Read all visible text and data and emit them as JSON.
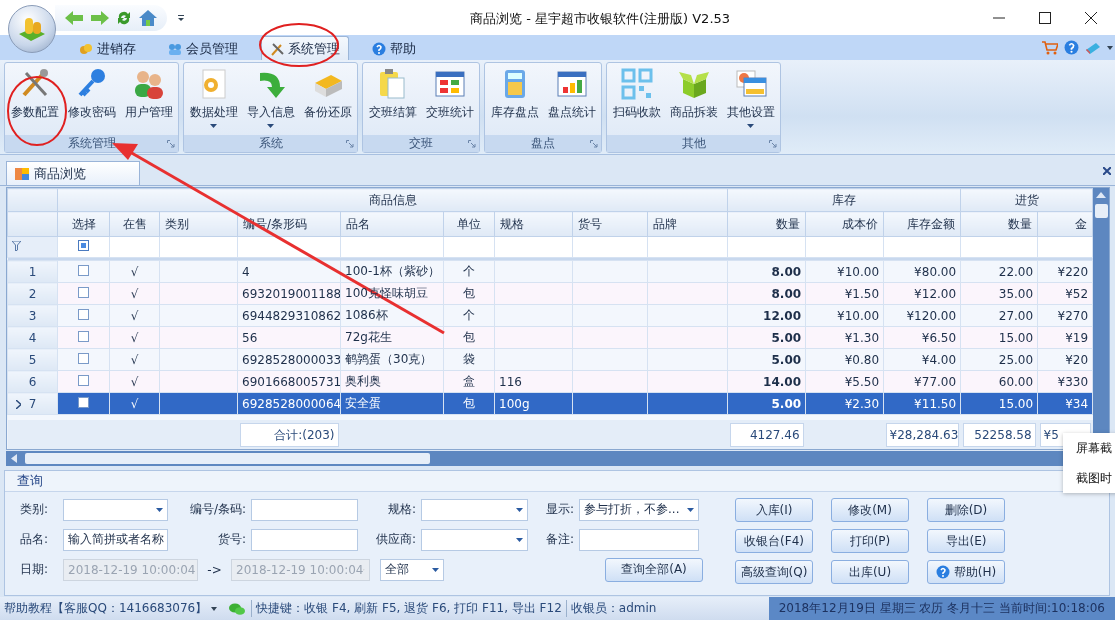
{
  "window": {
    "title": "商品浏览 - 星宇超市收银软件(注册版) V2.53"
  },
  "ribbon_tabs": [
    {
      "label": "进销存",
      "selected": false
    },
    {
      "label": "会员管理",
      "selected": false
    },
    {
      "label": "系统管理",
      "selected": true
    },
    {
      "label": "帮助",
      "selected": false
    }
  ],
  "ribbon_groups": [
    {
      "title": "系统管理",
      "buttons": [
        {
          "label": "参数配置",
          "dropdown": false
        },
        {
          "label": "修改密码",
          "dropdown": false
        },
        {
          "label": "用户管理",
          "dropdown": false
        }
      ]
    },
    {
      "title": "系统",
      "buttons": [
        {
          "label": "数据处理",
          "dropdown": true
        },
        {
          "label": "导入信息",
          "dropdown": true
        },
        {
          "label": "备份还原",
          "dropdown": false
        }
      ]
    },
    {
      "title": "交班",
      "buttons": [
        {
          "label": "交班结算",
          "dropdown": false
        },
        {
          "label": "交班统计",
          "dropdown": false
        }
      ]
    },
    {
      "title": "盘点",
      "buttons": [
        {
          "label": "库存盘点",
          "dropdown": false
        },
        {
          "label": "盘点统计",
          "dropdown": false
        }
      ]
    },
    {
      "title": "其他",
      "buttons": [
        {
          "label": "扫码收款",
          "dropdown": false
        },
        {
          "label": "商品拆装",
          "dropdown": false
        },
        {
          "label": "其他设置",
          "dropdown": true
        }
      ]
    }
  ],
  "document_tab": {
    "label": "商品浏览"
  },
  "table": {
    "select_all_indeterminate": true,
    "column_groups": [
      {
        "label": "商品信息",
        "columns": [
          {
            "label": "选择",
            "kind": "checkbox"
          },
          {
            "label": "在售",
            "kind": "text"
          },
          {
            "label": "类别",
            "kind": "text"
          },
          {
            "label": "编号/条形码",
            "kind": "text"
          },
          {
            "label": "品名",
            "kind": "text"
          },
          {
            "label": "单位",
            "kind": "text"
          },
          {
            "label": "规格",
            "kind": "text"
          },
          {
            "label": "货号",
            "kind": "text"
          },
          {
            "label": "品牌",
            "kind": "text"
          }
        ]
      },
      {
        "label": "库存",
        "columns": [
          {
            "label": "数量",
            "kind": "text"
          },
          {
            "label": "成本价",
            "kind": "text"
          },
          {
            "label": "库存金额",
            "kind": "text"
          }
        ]
      },
      {
        "label": "进货",
        "columns": [
          {
            "label": "数量",
            "kind": "text"
          },
          {
            "label": "金",
            "kind": "text"
          }
        ]
      }
    ],
    "rows": [
      {
        "number": "1",
        "selected": false,
        "checked": false,
        "values": {
          "on_sale": "√",
          "code": "4",
          "name": "100-1杯（紫砂）",
          "unit": "个",
          "qty": "8.00",
          "cost": "¥10.00",
          "value": "¥80.00",
          "in_qty": "22.00",
          "in_amount": "¥220"
        }
      },
      {
        "number": "2",
        "selected": false,
        "checked": false,
        "values": {
          "on_sale": "√",
          "code": "6932019001188",
          "name": "100克怪味胡豆",
          "unit": "包",
          "qty": "8.00",
          "cost": "¥1.50",
          "value": "¥12.00",
          "in_qty": "35.00",
          "in_amount": "¥52"
        }
      },
      {
        "number": "3",
        "selected": false,
        "checked": false,
        "values": {
          "on_sale": "√",
          "code": "6944829310862",
          "name": "1086杯",
          "unit": "个",
          "qty": "12.00",
          "cost": "¥10.00",
          "value": "¥120.00",
          "in_qty": "27.00",
          "in_amount": "¥270"
        }
      },
      {
        "number": "4",
        "selected": false,
        "checked": false,
        "values": {
          "on_sale": "√",
          "code": "56",
          "name": "72g花生",
          "unit": "包",
          "qty": "5.00",
          "cost": "¥1.30",
          "value": "¥6.50",
          "in_qty": "15.00",
          "in_amount": "¥19"
        }
      },
      {
        "number": "5",
        "selected": false,
        "checked": false,
        "values": {
          "on_sale": "√",
          "code": "6928528000033",
          "name": "鹌鹑蛋（30克）",
          "unit": "袋",
          "qty": "5.00",
          "cost": "¥0.80",
          "value": "¥4.00",
          "in_qty": "25.00",
          "in_amount": "¥20"
        }
      },
      {
        "number": "6",
        "selected": false,
        "checked": false,
        "values": {
          "on_sale": "√",
          "code": "6901668005731",
          "name": "奥利奥",
          "unit": "盒",
          "spec": "116",
          "qty": "14.00",
          "cost": "¥5.50",
          "value": "¥77.00",
          "in_qty": "60.00",
          "in_amount": "¥330"
        }
      },
      {
        "number": "7",
        "selected": true,
        "checked": false,
        "values": {
          "on_sale": "√",
          "code": "6928528000064",
          "name": "安全蛋",
          "unit": "包",
          "spec": "100g",
          "qty": "5.00",
          "cost": "¥2.30",
          "value": "¥11.50",
          "in_qty": "15.00",
          "in_amount": "¥34"
        }
      }
    ],
    "totals": {
      "code": "合计:(203)",
      "qty": "4127.46",
      "value": "¥28,284.63",
      "in_qty": "52258.58",
      "in_amount": "¥5"
    }
  },
  "query": {
    "title": "查询",
    "rows": [
      [
        {
          "label": "类别:",
          "kind": "combo",
          "disabled": false
        },
        {
          "label": "编号/条码:",
          "kind": "text",
          "disabled": false
        },
        {
          "label": "规格:",
          "kind": "combo",
          "disabled": false
        },
        {
          "label": "显示:",
          "kind": "combo",
          "value": "参与打折，不参...",
          "disabled": false
        }
      ],
      [
        {
          "label": "品名:",
          "kind": "text",
          "value": "输入简拼或者名称",
          "disabled": false
        },
        {
          "label": "货号:",
          "kind": "text",
          "disabled": false
        },
        {
          "label": "供应商:",
          "kind": "combo",
          "disabled": false
        },
        {
          "label": "备注:",
          "kind": "text",
          "disabled": false
        }
      ],
      [
        {
          "label": "日期:",
          "kind": "combo",
          "value": "2018-12-19 10:00:04",
          "disabled": true
        },
        {
          "label": "->",
          "kind": "combo",
          "value": "2018-12-19 10:00:04",
          "disabled": true
        },
        {
          "kind": "combo",
          "value": "全部",
          "disabled": false
        }
      ]
    ],
    "search_all_button": "查询全部(A)",
    "buttons": [
      {
        "label": "入库(I)",
        "kind": "plain"
      },
      {
        "label": "修改(M)",
        "kind": "plain"
      },
      {
        "label": "删除(D)",
        "kind": "plain"
      },
      {
        "label": "收银台(F4)",
        "kind": "plain"
      },
      {
        "label": "打印(P)",
        "kind": "plain"
      },
      {
        "label": "导出(E)",
        "kind": "plain"
      },
      {
        "label": "高级查询(Q)",
        "kind": "plain"
      },
      {
        "label": "出库(U)",
        "kind": "plain"
      },
      {
        "label": "帮助(H)",
        "kind": "help"
      }
    ]
  },
  "status_bar": {
    "help": "帮助教程【客服QQ：1416683076】",
    "shortcuts": "快捷键：收银 F4, 刷新 F5, 退货 F6, 打印 F11, 导出 F12",
    "cashier": "收银员：admin",
    "datetime": "2018年12月19日 星期三 农历 冬月十三 当前时间:10:18:06"
  },
  "context_menu": {
    "items": [
      "屏幕截",
      "截图时"
    ]
  }
}
